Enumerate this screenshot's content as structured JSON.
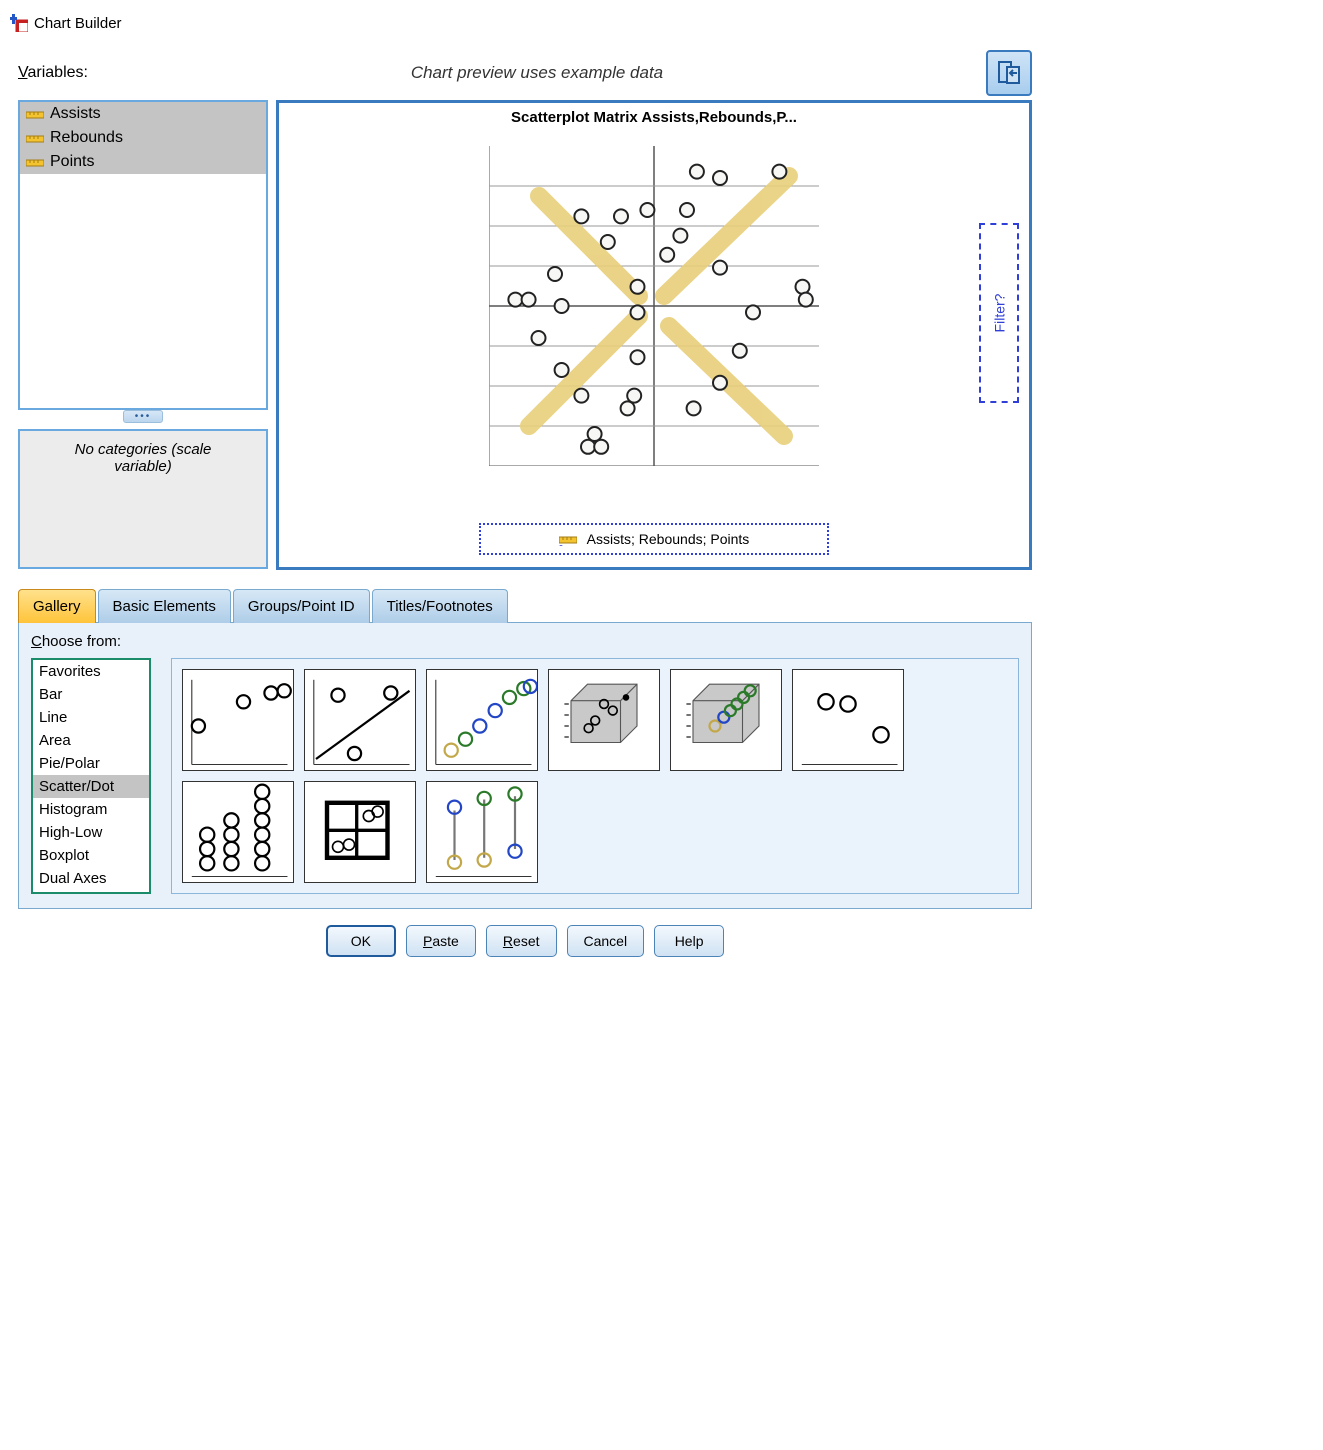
{
  "window": {
    "title": "Chart Builder"
  },
  "labels": {
    "variables": "Variables:",
    "preview_note": "Chart preview uses example data",
    "no_categories": "No categories (scale variable)",
    "choose_from": "Choose from:",
    "filter_drop": "Filter?"
  },
  "variables": [
    "Assists",
    "Rebounds",
    "Points"
  ],
  "preview": {
    "title": "Scatterplot Matrix Assists,Rebounds,P...",
    "dropzone_vars": "Assists; Rebounds; Points"
  },
  "tabs": [
    {
      "label": "Gallery",
      "active": true
    },
    {
      "label": "Basic Elements",
      "active": false
    },
    {
      "label": "Groups/Point ID",
      "active": false
    },
    {
      "label": "Titles/Footnotes",
      "active": false
    }
  ],
  "chart_types": [
    {
      "label": "Favorites",
      "selected": false
    },
    {
      "label": "Bar",
      "selected": false
    },
    {
      "label": "Line",
      "selected": false
    },
    {
      "label": "Area",
      "selected": false
    },
    {
      "label": "Pie/Polar",
      "selected": false
    },
    {
      "label": "Scatter/Dot",
      "selected": true
    },
    {
      "label": "Histogram",
      "selected": false
    },
    {
      "label": "High-Low",
      "selected": false
    },
    {
      "label": "Boxplot",
      "selected": false
    },
    {
      "label": "Dual Axes",
      "selected": false
    }
  ],
  "gallery_thumbs": [
    "simple-scatter",
    "scatter-fit-line",
    "grouped-scatter",
    "3d-scatter",
    "grouped-3d-scatter",
    "simple-dot",
    "dot-plot",
    "scatter-matrix",
    "drop-line"
  ],
  "buttons": {
    "ok": "OK",
    "paste": "Paste",
    "reset": "Reset",
    "cancel": "Cancel",
    "help": "Help"
  },
  "chart_data": {
    "type": "scatter",
    "title": "Scatterplot Matrix Assists,Rebounds,P...",
    "note": "Chart preview uses example data",
    "variables_in_matrix": [
      "Assists",
      "Rebounds",
      "Points"
    ],
    "example_points": [
      {
        "x": 0.08,
        "y": 0.52
      },
      {
        "x": 0.12,
        "y": 0.52
      },
      {
        "x": 0.22,
        "y": 0.5
      },
      {
        "x": 0.15,
        "y": 0.4
      },
      {
        "x": 0.22,
        "y": 0.3
      },
      {
        "x": 0.28,
        "y": 0.22
      },
      {
        "x": 0.3,
        "y": 0.06
      },
      {
        "x": 0.32,
        "y": 0.1
      },
      {
        "x": 0.34,
        "y": 0.06
      },
      {
        "x": 0.42,
        "y": 0.18
      },
      {
        "x": 0.44,
        "y": 0.22
      },
      {
        "x": 0.45,
        "y": 0.34
      },
      {
        "x": 0.45,
        "y": 0.48
      },
      {
        "x": 0.45,
        "y": 0.56
      },
      {
        "x": 0.4,
        "y": 0.78
      },
      {
        "x": 0.48,
        "y": 0.8
      },
      {
        "x": 0.36,
        "y": 0.7
      },
      {
        "x": 0.28,
        "y": 0.78
      },
      {
        "x": 0.63,
        "y": 0.92
      },
      {
        "x": 0.7,
        "y": 0.9
      },
      {
        "x": 0.88,
        "y": 0.92
      },
      {
        "x": 0.6,
        "y": 0.8
      },
      {
        "x": 0.58,
        "y": 0.72
      },
      {
        "x": 0.7,
        "y": 0.62
      },
      {
        "x": 0.95,
        "y": 0.56
      },
      {
        "x": 0.96,
        "y": 0.52
      },
      {
        "x": 0.8,
        "y": 0.48
      },
      {
        "x": 0.76,
        "y": 0.36
      },
      {
        "x": 0.7,
        "y": 0.26
      },
      {
        "x": 0.62,
        "y": 0.18
      },
      {
        "x": 0.54,
        "y": 0.66
      },
      {
        "x": 0.2,
        "y": 0.6
      }
    ]
  }
}
